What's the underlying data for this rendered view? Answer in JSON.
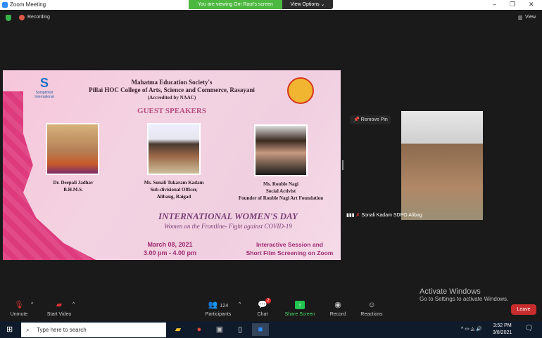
{
  "window": {
    "title": "Zoom Meeting",
    "minimize": "–",
    "restore": "❐",
    "close": "✕"
  },
  "banner": {
    "viewing": "You are viewing Om Raut's screen",
    "view_options": "View Options ⌄"
  },
  "topbar": {
    "recording": "Recording",
    "view": "View"
  },
  "shared": {
    "logo_left": "Soroptimist International",
    "org1": "Mahatma Education Society's",
    "org2": "Pillai HOC College of Arts, Science and Commerce, Rasayani",
    "org3": "(Accredited by NAAC)",
    "heading": "GUEST SPEAKERS",
    "speakers": [
      {
        "name": "Dr. Deepali Jadhav",
        "line2": "B.H.M.S.",
        "line3": ""
      },
      {
        "name": "Ms. Sonali Tukaram Kadam",
        "line2": "Sub-divisional Officer,",
        "line3": "Alibaug, Raigad"
      },
      {
        "name": "Ms. Rouble Nagi",
        "line2": "Social Activist",
        "line3": "Founder of Rouble Nagi Art Foundation"
      }
    ],
    "event_title": "INTERNATIONAL WOMEN'S DAY",
    "event_subtitle": "Women on the Frontline- Fight against COVID-19",
    "date": "March 08, 2021",
    "time": "3.00 pm - 4.00 pm",
    "session1": "Interactive Session and",
    "session2": "Short Film Screening on Zoom"
  },
  "video": {
    "remove_pin": "Remove Pin",
    "participant": "Sonali Kadam SDPO Alibag"
  },
  "watermark": {
    "line1": "Activate Windows",
    "line2": "Go to Settings to activate Windows."
  },
  "toolbar": {
    "unmute": "Unmute",
    "start_video": "Start Video",
    "participants": "Participants",
    "participant_count": "124",
    "chat": "Chat",
    "chat_badge": "2",
    "share": "Share Screen",
    "record": "Record",
    "reactions": "Reactions",
    "leave": "Leave"
  },
  "taskbar": {
    "search_placeholder": "Type here to search",
    "time": "3:52 PM",
    "date": "3/8/2021"
  }
}
